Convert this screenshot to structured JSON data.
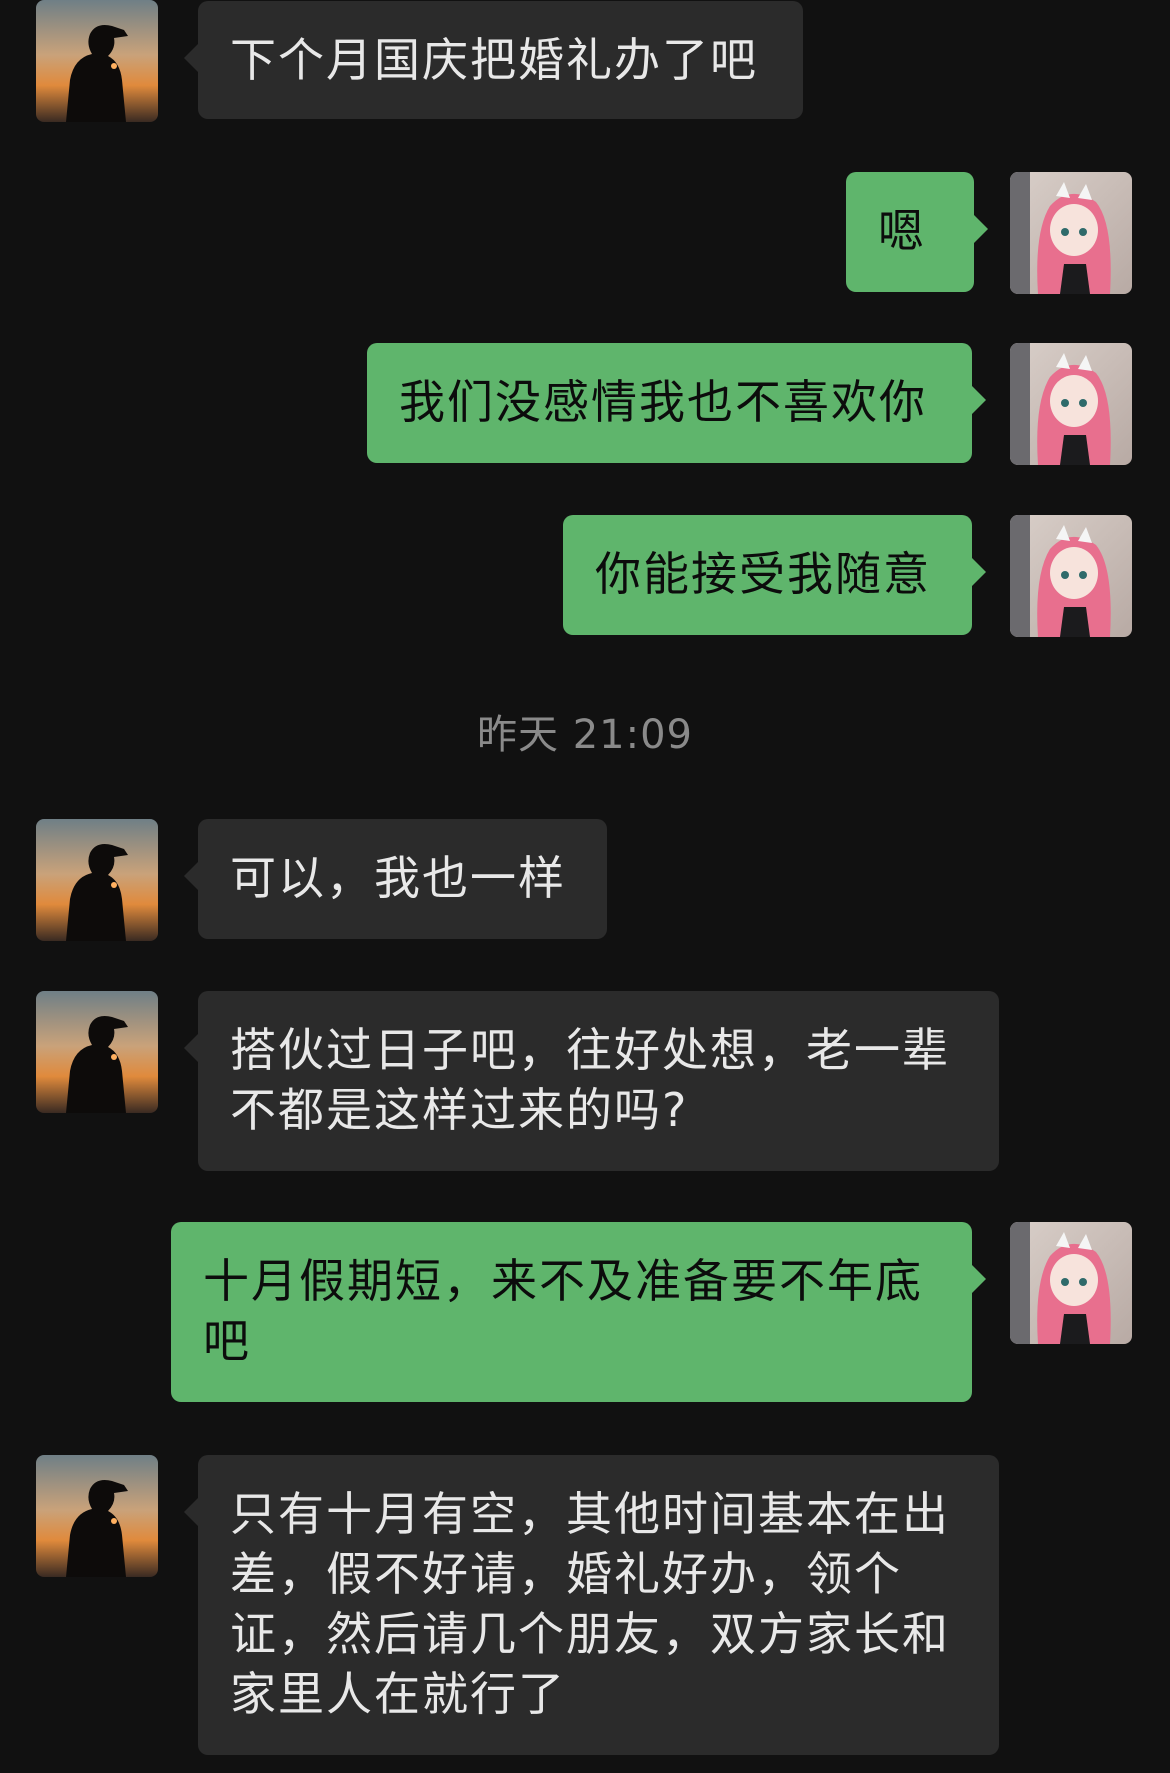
{
  "colors": {
    "background": "#111111",
    "left_bubble": "#2b2b2b",
    "right_bubble": "#5fb56c",
    "timestamp_text": "#8a8a8a"
  },
  "timestamp": "昨天 21:09",
  "messages": [
    {
      "side": "left",
      "avatar": "silhouette-avatar",
      "text": "下个月国庆把婚礼办了吧"
    },
    {
      "side": "right",
      "avatar": "anime-girl-avatar",
      "text": "嗯"
    },
    {
      "side": "right",
      "avatar": "anime-girl-avatar",
      "text": "我们没感情我也不喜欢你"
    },
    {
      "side": "right",
      "avatar": "anime-girl-avatar",
      "text": "你能接受我随意"
    },
    {
      "side": "left",
      "avatar": "silhouette-avatar",
      "text": "可以，我也一样"
    },
    {
      "side": "left",
      "avatar": "silhouette-avatar",
      "text": "搭伙过日子吧，往好处想，老一辈不都是这样过来的吗?"
    },
    {
      "side": "right",
      "avatar": "anime-girl-avatar",
      "text": "十月假期短，来不及准备要不年底吧"
    },
    {
      "side": "left",
      "avatar": "silhouette-avatar",
      "text": "只有十月有空，其他时间基本在出差，假不好请，婚礼好办，领个证，然后请几个朋友，双方家长和家里人在就行了"
    }
  ]
}
